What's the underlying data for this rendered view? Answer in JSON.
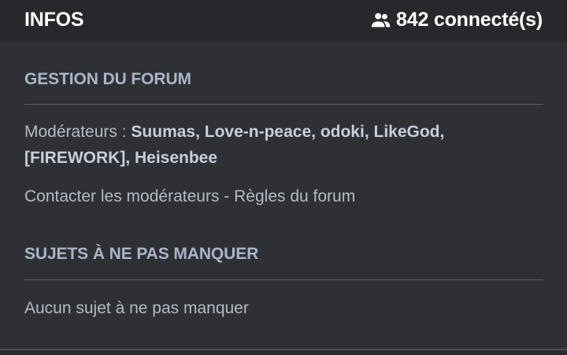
{
  "header": {
    "title": "INFOS",
    "online_count": "842 connecté(s)",
    "online_icon": "users-icon"
  },
  "management": {
    "title": "GESTION DU FORUM",
    "moderators_label": "Modérateurs : ",
    "moderators": [
      "Suumas",
      "Love-n-peace",
      "odoki",
      "LikeGod",
      "[FIREWORK]",
      "Heisenbee"
    ],
    "contact_link": "Contacter les modérateurs",
    "separator": " - ",
    "rules_link": "Règles du forum"
  },
  "featured": {
    "title": "SUJETS À NE PAS MANQUER",
    "empty_text": "Aucun sujet à ne pas manquer"
  },
  "colors": {
    "background": "#2e3035",
    "header_bg": "#26282c",
    "section_title": "#aab6c7",
    "text": "#b5bbc4"
  }
}
